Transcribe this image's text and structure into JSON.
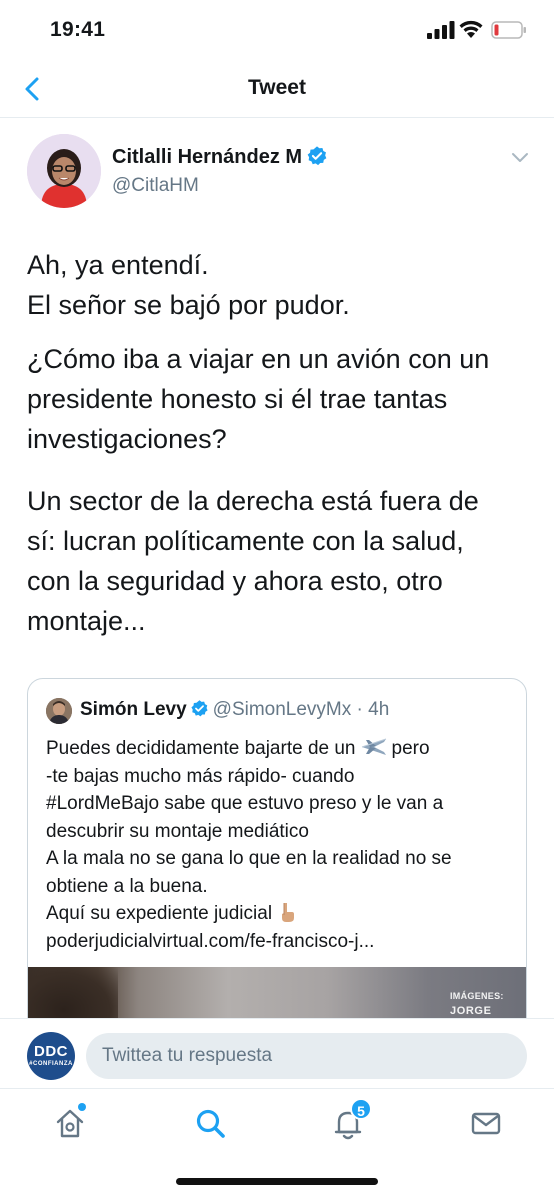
{
  "status_bar": {
    "time": "19:41",
    "icons": [
      "signal-icon",
      "wifi-icon",
      "battery-low-icon"
    ],
    "battery_color": "#e0393e"
  },
  "nav": {
    "back_icon": "chevron-left-icon",
    "title": "Tweet"
  },
  "tweet": {
    "author_name": "Citlalli Hernández M",
    "author_handle": "@CitlaHM",
    "verified": true,
    "paragraphs": [
      [
        "Ah, ya entendí.",
        "El señor se bajó por pudor."
      ],
      [
        "¿Cómo iba a viajar en un avión con un",
        "presidente honesto si él trae tantas",
        "investigaciones?"
      ],
      [
        "Un sector de la derecha está fuera de",
        "sí: lucran políticamente con la salud,",
        "con la seguridad y ahora esto, otro",
        "montaje..."
      ]
    ]
  },
  "quote": {
    "name": "Simón Levy",
    "handle": "@SimonLevyMx",
    "separator": "·",
    "time": "4h",
    "verified": true,
    "line1_before": "Puedes decididamente bajarte de un",
    "line1_after": "pero",
    "line2": "-te bajas mucho más rápido- cuando",
    "line3": "#LordMeBajo sabe que estuvo preso y le van a",
    "line4": "descubrir su montaje mediático",
    "line5": "A la mala no se gana lo que en la realidad no se",
    "line6": "obtiene a la buena.",
    "line7": "Aquí su expediente judicial",
    "line8": "poderjudicialvirtual.com/fe-francisco-j...",
    "image_caption_top": "IMÁGENES:",
    "image_caption_bottom": "JORGE"
  },
  "reply_bar": {
    "logo_text": "DDC",
    "logo_subtext": "#CONFIANZA",
    "placeholder": "Twittea tu respuesta"
  },
  "tab_bar": {
    "tabs": [
      "home-icon",
      "search-icon",
      "notifications-icon",
      "messages-icon"
    ],
    "notification_count": "5"
  },
  "colors": {
    "accent": "#1da1f2",
    "text_primary": "#14171a",
    "text_secondary": "#657786",
    "border": "#e6ecf0"
  }
}
